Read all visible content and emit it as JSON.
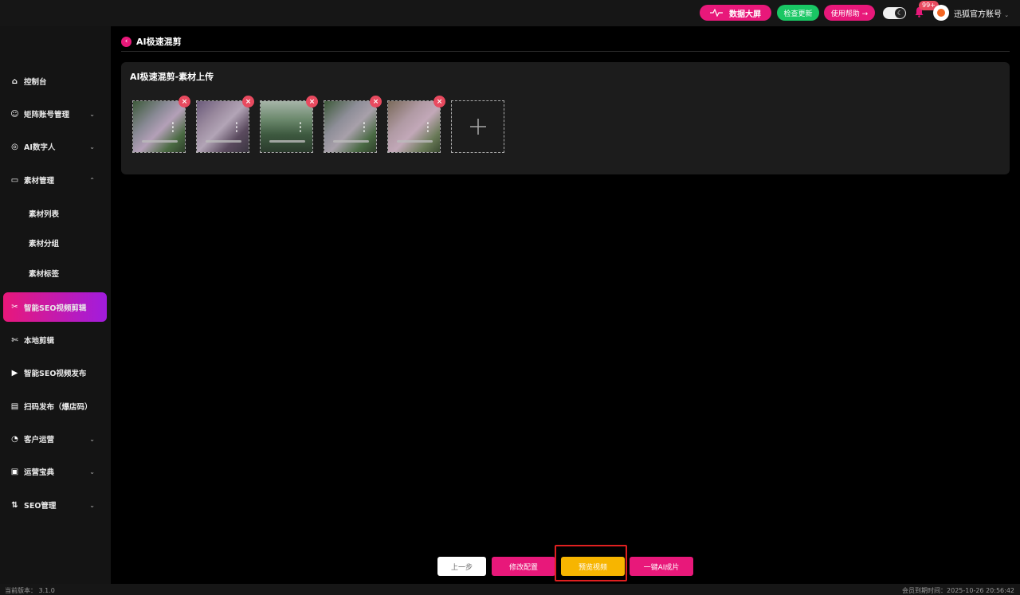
{
  "topbar": {
    "data_screen_label": "数据大屏",
    "check_update_label": "检查更新",
    "help_label": "使用帮助 →",
    "notification_count": "99+",
    "account_name": "迅狐官方账号",
    "theme_icon": "moon-icon",
    "colors": {
      "pink": "#e8187a",
      "green": "#19c764"
    }
  },
  "sidebar": {
    "items": [
      {
        "label": "控制台",
        "icon": "home-icon"
      },
      {
        "label": "矩阵账号管理",
        "icon": "smile-icon",
        "expandable": true
      },
      {
        "label": "AI数字人",
        "icon": "robot-icon",
        "expandable": true
      },
      {
        "label": "素材管理",
        "icon": "folder-icon",
        "expanded": true
      },
      {
        "label": "素材列表"
      },
      {
        "label": "素材分组"
      },
      {
        "label": "素材标签"
      },
      {
        "label": "智能SEO视频剪辑",
        "icon": "scissors-icon",
        "active": true
      },
      {
        "label": "本地剪辑",
        "icon": "cut-icon"
      },
      {
        "label": "智能SEO视频发布",
        "icon": "video-icon"
      },
      {
        "label": "扫码发布（爆店码）",
        "icon": "qrcode-icon"
      },
      {
        "label": "客户运营",
        "icon": "pie-icon",
        "expandable": true
      },
      {
        "label": "运营宝典",
        "icon": "book-icon",
        "expandable": true
      },
      {
        "label": "SEO管理",
        "icon": "sort-icon",
        "expandable": true
      }
    ]
  },
  "header": {
    "title": "AI极速混剪"
  },
  "panel": {
    "title": "AI极速混剪-素材上传",
    "thumbnails": [
      {
        "name": "thumb-1"
      },
      {
        "name": "thumb-2"
      },
      {
        "name": "thumb-3"
      },
      {
        "name": "thumb-4"
      },
      {
        "name": "thumb-5"
      }
    ]
  },
  "actions": {
    "prev": "上一步",
    "config": "修改配置",
    "preview": "预览视频",
    "generate": "一键AI成片"
  },
  "footer": {
    "version": "当前版本： 3.1.0",
    "expiry": "会员到期时间：2025-10-26 20:56:42"
  }
}
